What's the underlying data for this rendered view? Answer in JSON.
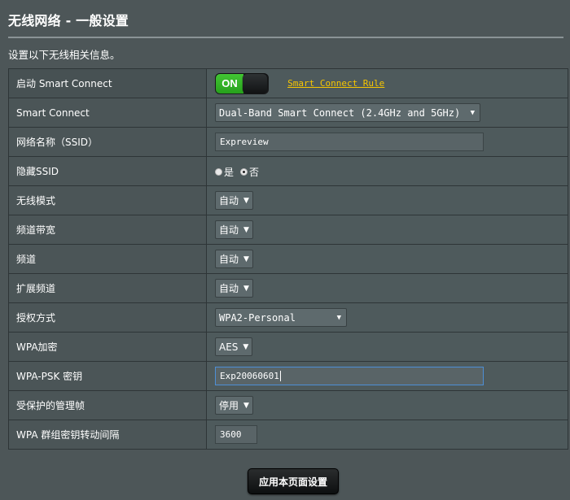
{
  "header": {
    "title": "无线网络 - 一般设置",
    "description": "设置以下无线相关信息。"
  },
  "rows": {
    "smart_connect_toggle": {
      "label": "启动 Smart Connect",
      "toggle_state": "ON",
      "link": "Smart Connect Rule"
    },
    "smart_connect_mode": {
      "label": "Smart Connect",
      "value": "Dual-Band Smart Connect (2.4GHz and 5GHz)"
    },
    "ssid": {
      "label": "网络名称（SSID）",
      "value": "Expreview"
    },
    "hide_ssid": {
      "label": "隐藏SSID",
      "option_yes": "是",
      "option_no": "否",
      "selected": "否"
    },
    "wireless_mode": {
      "label": "无线模式",
      "value": "自动"
    },
    "bandwidth": {
      "label": "频道带宽",
      "value": "自动"
    },
    "channel": {
      "label": "频道",
      "value": "自动"
    },
    "ext_channel": {
      "label": "扩展频道",
      "value": "自动"
    },
    "auth_method": {
      "label": "授权方式",
      "value": "WPA2-Personal"
    },
    "wpa_encryption": {
      "label": "WPA加密",
      "value": "AES"
    },
    "wpa_psk": {
      "label": "WPA-PSK 密钥",
      "value": "Exp20060601"
    },
    "pmf": {
      "label": "受保护的管理帧",
      "value": "停用"
    },
    "rekey_interval": {
      "label": "WPA 群组密钥转动间隔",
      "value": "3600"
    }
  },
  "footer": {
    "apply_label": "应用本页面设置"
  },
  "colors": {
    "background": "#4d5658",
    "toggle_on": "#31b226",
    "link": "#f7c600",
    "focus_border": "#4d8fd6"
  }
}
